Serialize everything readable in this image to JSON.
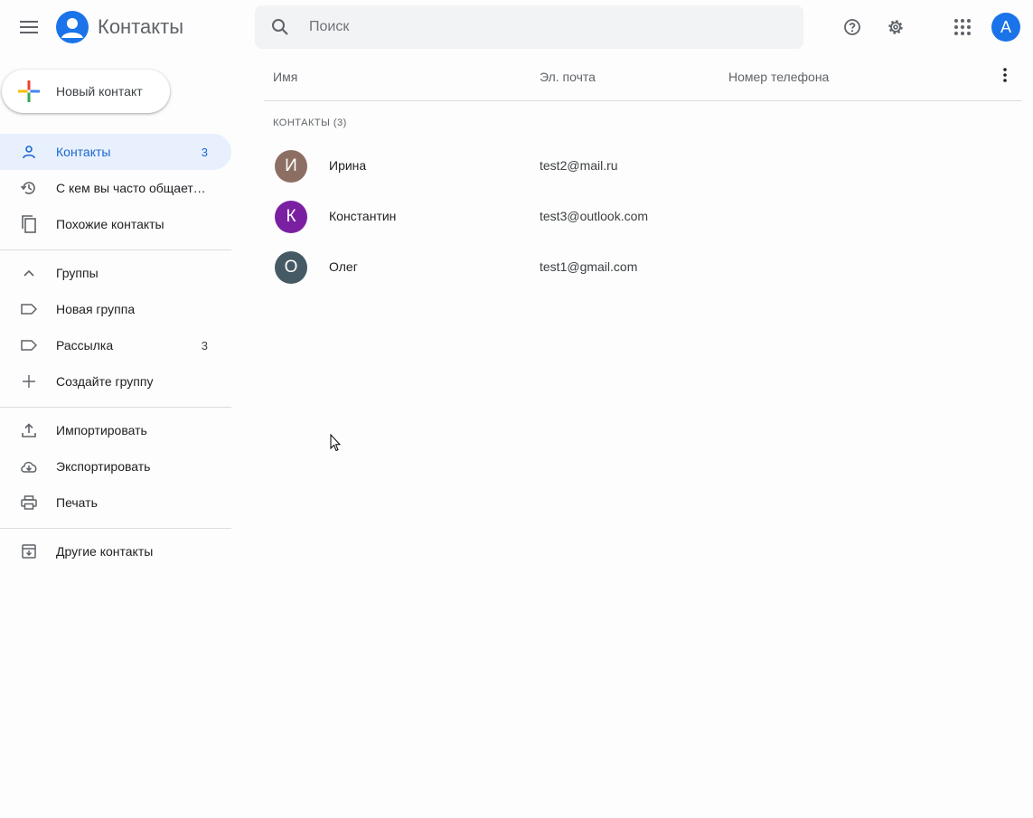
{
  "header": {
    "menu_icon": "hamburger-menu-icon",
    "logo_icon": "contacts-person-icon",
    "app_title": "Контакты",
    "search": {
      "placeholder": "Поиск",
      "value": ""
    },
    "help_icon": "help-circle-icon",
    "settings_icon": "gear-icon",
    "apps_icon": "apps-grid-icon",
    "account_initial": "A",
    "account_color": "#1a73e8"
  },
  "sidebar": {
    "new_contact_label": "Новый контакт",
    "nav": [
      {
        "label": "Контакты",
        "count": "3",
        "icon": "person-icon",
        "active": true
      },
      {
        "label": "С кем вы часто общаетесь",
        "count": "",
        "icon": "history-icon",
        "active": false
      },
      {
        "label": "Похожие контакты",
        "count": "",
        "icon": "copy-icon",
        "active": false
      }
    ],
    "groups_header": {
      "label": "Группы",
      "icon": "chevron-up-icon"
    },
    "groups": [
      {
        "label": "Новая группа",
        "count": "",
        "icon": "label-icon"
      },
      {
        "label": "Рассылка",
        "count": "3",
        "icon": "label-icon"
      }
    ],
    "create_group": {
      "label": "Создайте группу",
      "icon": "plus-icon"
    },
    "tools": [
      {
        "label": "Импортировать",
        "icon": "upload-icon"
      },
      {
        "label": "Экспортировать",
        "icon": "cloud-download-icon"
      },
      {
        "label": "Печать",
        "icon": "printer-icon"
      }
    ],
    "other_contacts": {
      "label": "Другие контакты",
      "icon": "archive-icon"
    }
  },
  "main": {
    "columns": {
      "name": "Имя",
      "email": "Эл. почта",
      "phone": "Номер телефона"
    },
    "more_icon": "more-vertical-icon",
    "section_label": "КОНТАКТЫ (3)",
    "contacts": [
      {
        "initial": "И",
        "name": "Ирина",
        "email": "test2@mail.ru",
        "phone": "",
        "color": "#8d6e63"
      },
      {
        "initial": "К",
        "name": "Константин",
        "email": "test3@outlook.com",
        "phone": "",
        "color": "#7b1fa2"
      },
      {
        "initial": "О",
        "name": "Олег",
        "email": "test1@gmail.com",
        "phone": "",
        "color": "#455a64"
      }
    ]
  },
  "colors": {
    "accent": "#1a73e8",
    "active_bg": "#e8f0fe",
    "active_text": "#1967d2"
  }
}
